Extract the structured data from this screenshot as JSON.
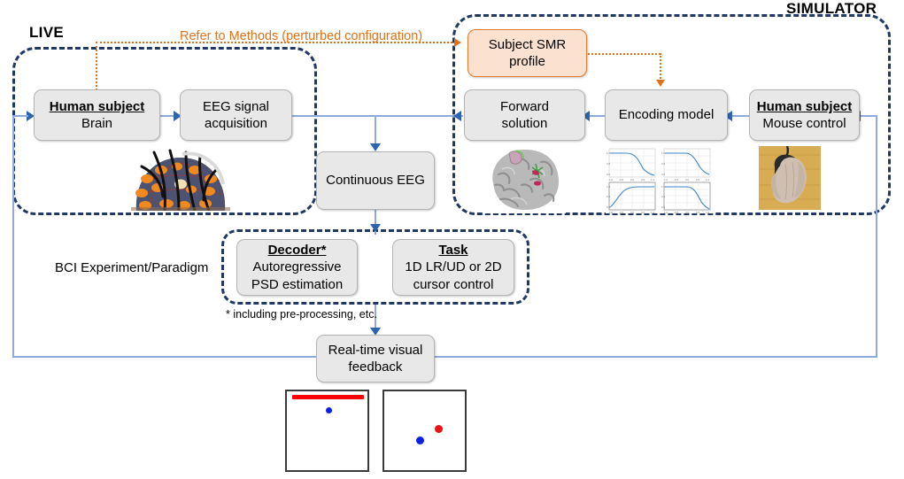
{
  "figure": {
    "groups": [
      {
        "id": "live",
        "label": "LIVE"
      },
      {
        "id": "simulator",
        "label": "SIMULATOR"
      },
      {
        "id": "bci",
        "label": "BCI Experiment/Paradigm"
      }
    ],
    "boxes": {
      "human_subject_brain": {
        "title": "Human subject",
        "subtitle": "Brain"
      },
      "eeg_acquisition": {
        "line1": "EEG signal",
        "line2": "acquisition"
      },
      "continuous_eeg": {
        "line1": "Continuous EEG"
      },
      "subject_smr_profile": {
        "line1": "Subject SMR",
        "line2": "profile"
      },
      "forward_solution": {
        "line1": "Forward",
        "line2": "solution"
      },
      "encoding_model": {
        "line1": "Encoding model"
      },
      "human_subject_mouse": {
        "title": "Human subject",
        "subtitle": "Mouse control"
      },
      "decoder": {
        "title": "Decoder*",
        "line1": "Autoregressive",
        "line2": "PSD estimation"
      },
      "task": {
        "title": "Task",
        "line1": "1D LR/UD or 2D",
        "line2": "cursor control"
      },
      "realtime_feedback": {
        "line1": "Real-time visual",
        "line2": "feedback"
      }
    },
    "annotations": {
      "perturbed_note": "Refer to Methods (perturbed configuration)",
      "decoder_footnote": "* including pre-processing, etc."
    },
    "thumbnails": {
      "eeg_cap": "eeg-cap-photo",
      "cortex_surface": "brain-cortex-render",
      "tuning_curves": "encoding-tuning-curve-plots",
      "mouse_hand": "hand-on-mouse-photo"
    },
    "feedback_screens": [
      {
        "id": "one-d",
        "target": "top-bar",
        "cursor": "blue-dot"
      },
      {
        "id": "two-d",
        "target": "red-dot",
        "cursor": "blue-dot"
      }
    ],
    "colors": {
      "group_border": "#1F3864",
      "connector": "#8EAADB",
      "arrow": "#2E63B0",
      "accent_orange": "#E0711B",
      "smr_fill": "#FBE2D0",
      "box_fill": "#E8E8E8",
      "target_red": "#FF0000",
      "cursor_blue": "#0A20E8"
    }
  }
}
